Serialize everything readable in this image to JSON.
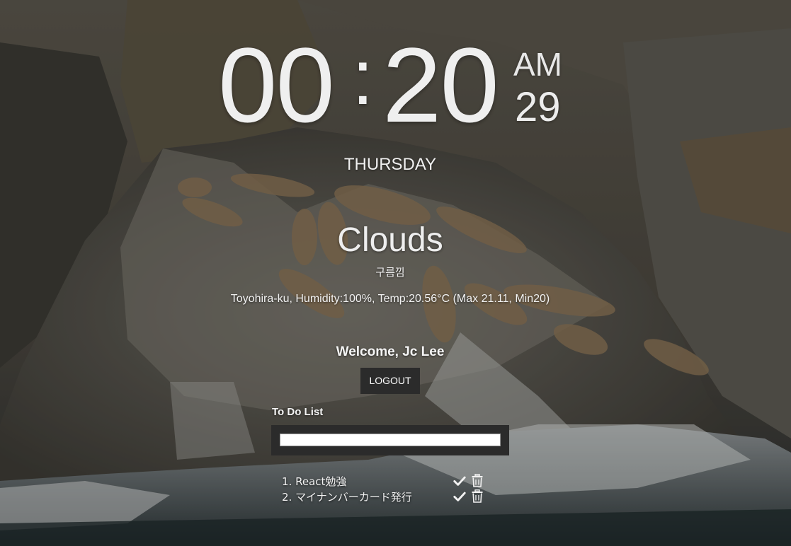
{
  "clock": {
    "hours": "00",
    "separator": ":",
    "minutes": "20",
    "ampm": "AM",
    "seconds": "29"
  },
  "day": "THURSDAY",
  "weather": {
    "main": "Clouds",
    "description": "구름낌",
    "detail": "Toyohira-ku, Humidity:100%, Temp:20.56°C (Max 21.11, Min20)"
  },
  "user": {
    "welcome": "Welcome, Jc Lee",
    "logout_label": "LOGOUT"
  },
  "todo": {
    "title": "To Do List",
    "input_value": "",
    "items": [
      {
        "text": "1. React勉強",
        "check_icon": "check-icon",
        "delete_icon": "trash-icon"
      },
      {
        "text": "2. マイナンバーカード発行",
        "check_icon": "check-icon",
        "delete_icon": "trash-icon"
      }
    ]
  },
  "colors": {
    "text": "#f2f2f2",
    "button_bg": "#2b2b2b",
    "input_bg": "#ffffff"
  },
  "background": {
    "image": "sea-lions-on-rocks-photo"
  }
}
